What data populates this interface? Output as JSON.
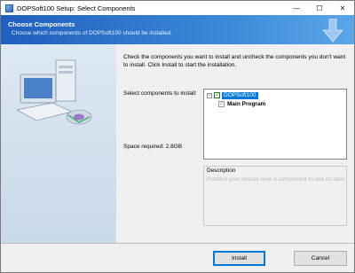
{
  "window": {
    "title": "DOPSoft100 Setup: Select Components",
    "controls": {
      "minimize": "—",
      "maximize": "☐",
      "close": "✕"
    }
  },
  "header": {
    "title": "Choose Components",
    "subtitle": "Choose which components of DOPSoft100 should be installed.",
    "banner_color": "#2a6fcb"
  },
  "instructions": "Check the components you want to install and uncheck the components you don't want to install. Click Install to start the installation.",
  "components": {
    "label": "Select components to install:",
    "tree": {
      "root": {
        "label": "DOPSoft100",
        "checked": true,
        "expanded": true,
        "expander_symbol": "−"
      },
      "children": [
        {
          "label": "Main Program",
          "checked": true,
          "disabled": true
        }
      ]
    }
  },
  "space_required": "Space required: 2.8GB",
  "description": {
    "title": "Description",
    "hint": "Position your mouse over a component to see its description."
  },
  "buttons": {
    "install": "Install",
    "cancel": "Cancel"
  },
  "icons": {
    "app": "installer-icon",
    "banner": "download-arrow-icon",
    "illustration": "computer-icon"
  }
}
